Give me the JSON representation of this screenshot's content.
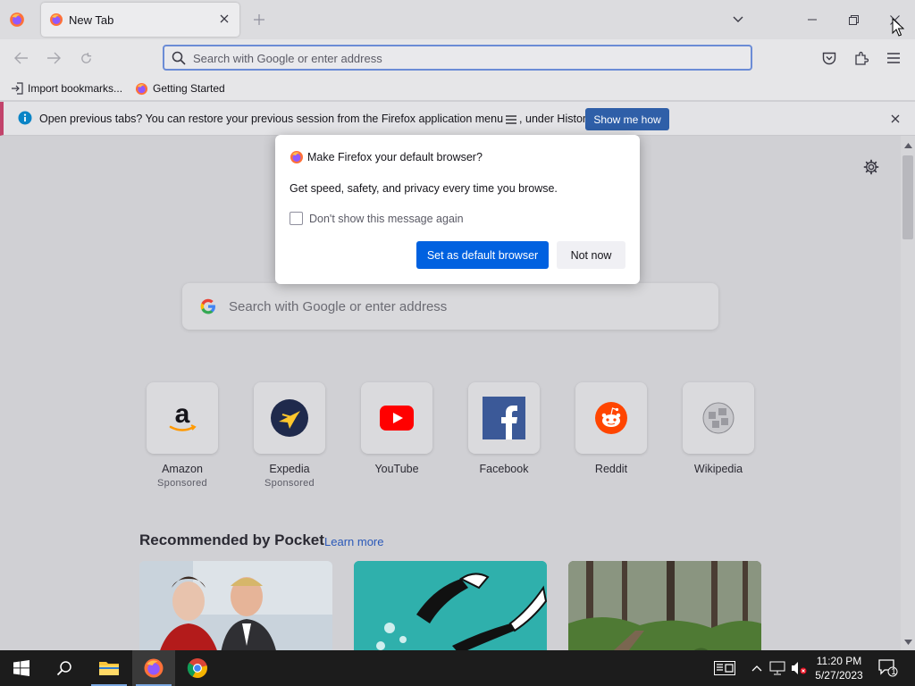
{
  "window": {
    "tab_title": "New Tab"
  },
  "navbar": {
    "url_placeholder": "Search with Google or enter address"
  },
  "bookmarks": [
    {
      "label": "Import bookmarks..."
    },
    {
      "label": "Getting Started"
    }
  ],
  "notification": {
    "message_pre": "Open previous tabs? You can restore your previous session from the Firefox application menu",
    "message_post": ", under History.",
    "button": "Show me how"
  },
  "dialog": {
    "title": "Make Firefox your default browser?",
    "body": "Get speed, safety, and privacy every time you browse.",
    "checkbox_label": "Don't show this message again",
    "checkbox_checked": false,
    "primary_button": "Set as default browser",
    "secondary_button": "Not now"
  },
  "newtab": {
    "search_placeholder": "Search with Google or enter address",
    "top_sites": [
      {
        "name": "Amazon",
        "sponsored": "Sponsored",
        "icon": "amazon-icon"
      },
      {
        "name": "Expedia",
        "sponsored": "Sponsored",
        "icon": "expedia-icon"
      },
      {
        "name": "YouTube",
        "sponsored": "",
        "icon": "youtube-icon"
      },
      {
        "name": "Facebook",
        "sponsored": "",
        "icon": "facebook-icon"
      },
      {
        "name": "Reddit",
        "sponsored": "",
        "icon": "reddit-icon"
      },
      {
        "name": "Wikipedia",
        "sponsored": "",
        "icon": "wikipedia-icon"
      }
    ],
    "pocket_title": "Recommended by Pocket",
    "pocket_learn_more": "Learn more"
  },
  "taskbar": {
    "time": "11:20 PM",
    "date": "5/27/2023",
    "notification_count": "1"
  },
  "colors": {
    "accent_blue": "#0061e0",
    "notification_button": "#2f5fa8",
    "taskbar": "#1c1c1c"
  }
}
